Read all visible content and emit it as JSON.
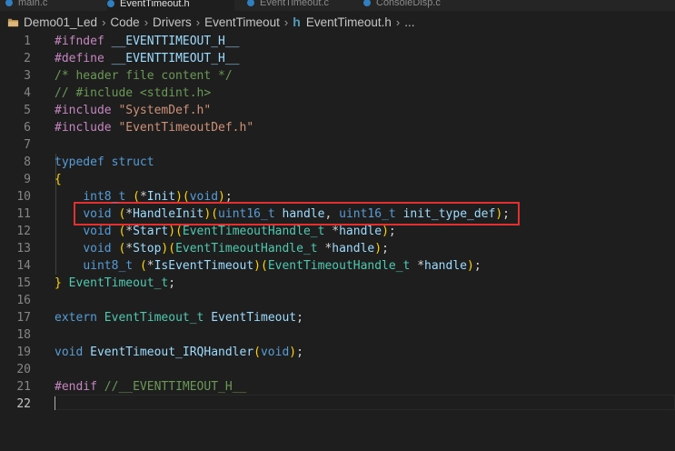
{
  "tabs": [
    {
      "label": "main.c",
      "active": false
    },
    {
      "label": "EventTimeout.h",
      "active": true
    },
    {
      "label": "EventTimeout.c",
      "active": false
    },
    {
      "label": "ConsoleDisp.c",
      "active": false
    }
  ],
  "breadcrumb": {
    "items": [
      "Demo01_Led",
      "Code",
      "Drivers",
      "EventTimeout",
      "EventTimeout.h",
      "..."
    ],
    "icons": [
      "folder-icon",
      "h-file-icon"
    ]
  },
  "editor": {
    "current_line": 22,
    "highlighted_line": 11,
    "colors": {
      "background": "#1e1e1e",
      "highlight_box": "#e03030",
      "keyword": "#569cd6",
      "preprocessor": "#c586c0",
      "string": "#ce9178",
      "comment": "#6a9955",
      "type": "#4ec9b0",
      "function": "#dcdcaa"
    },
    "lines": [
      {
        "n": "1",
        "t": "#ifndef __EVENTTIMEOUT_H__"
      },
      {
        "n": "2",
        "t": "#define __EVENTTIMEOUT_H__"
      },
      {
        "n": "3",
        "t": "/* header file content */"
      },
      {
        "n": "4",
        "t": "// #include <stdint.h>"
      },
      {
        "n": "5",
        "t": "#include \"SystemDef.h\""
      },
      {
        "n": "6",
        "t": "#include \"EventTimeoutDef.h\""
      },
      {
        "n": "7",
        "t": ""
      },
      {
        "n": "8",
        "t": "typedef struct"
      },
      {
        "n": "9",
        "t": "{"
      },
      {
        "n": "10",
        "t": "    int8_t (*Init)(void);"
      },
      {
        "n": "11",
        "t": "    void (*HandleInit)(uint16_t handle, uint16_t init_type_def);"
      },
      {
        "n": "12",
        "t": "    void (*Start)(EventTimeoutHandle_t *handle);"
      },
      {
        "n": "13",
        "t": "    void (*Stop)(EventTimeoutHandle_t *handle);"
      },
      {
        "n": "14",
        "t": "    uint8_t (*IsEventTimeout)(EventTimeoutHandle_t *handle);"
      },
      {
        "n": "15",
        "t": "} EventTimeout_t;"
      },
      {
        "n": "16",
        "t": ""
      },
      {
        "n": "17",
        "t": "extern EventTimeout_t EventTimeout;"
      },
      {
        "n": "18",
        "t": ""
      },
      {
        "n": "19",
        "t": "void EventTimeout_IRQHandler(void);"
      },
      {
        "n": "20",
        "t": ""
      },
      {
        "n": "21",
        "t": "#endif //__EVENTTIMEOUT_H__"
      },
      {
        "n": "22",
        "t": ""
      }
    ]
  }
}
